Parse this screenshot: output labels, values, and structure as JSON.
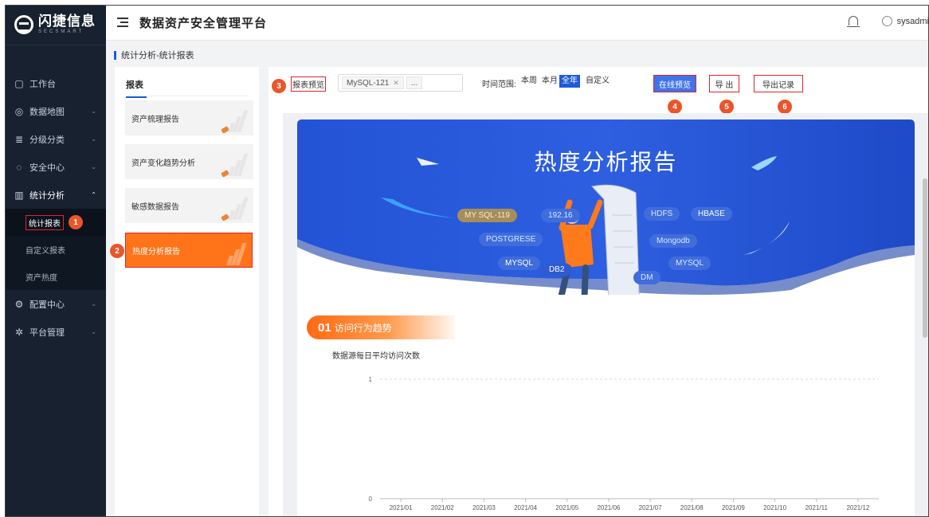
{
  "brand": {
    "name_cn": "闪捷信息",
    "name_en": "SECSMART"
  },
  "app": {
    "title": "数据资产安全管理平台"
  },
  "user": {
    "name": "sysadmi"
  },
  "breadcrumb": "统计分析-统计报表",
  "sidebar": {
    "items": [
      {
        "label": "工作台",
        "icon": "monitor-icon",
        "caret": false
      },
      {
        "label": "数据地图",
        "icon": "map-pin-icon",
        "caret": true
      },
      {
        "label": "分级分类",
        "icon": "layers-icon",
        "caret": true
      },
      {
        "label": "安全中心",
        "icon": "shield-icon",
        "caret": true
      },
      {
        "label": "统计分析",
        "icon": "bar-chart-icon",
        "caret": true,
        "open": true
      },
      {
        "label": "配置中心",
        "icon": "config-icon",
        "caret": true
      },
      {
        "label": "平台管理",
        "icon": "gear-icon",
        "caret": true
      }
    ],
    "sub_items": [
      {
        "label": "统计报表",
        "active": true
      },
      {
        "label": "自定义报表",
        "active": false
      },
      {
        "label": "资产热度",
        "active": false
      }
    ]
  },
  "report_panel": {
    "tab": "报表",
    "cards": [
      {
        "label": "资产梳理报告"
      },
      {
        "label": "资产变化趋势分析"
      },
      {
        "label": "敏感数据报告"
      },
      {
        "label": "热度分析报告",
        "active": true
      }
    ]
  },
  "toolbar": {
    "preview_label": "报表预览",
    "selected_tag": "MySQL-121",
    "more_tag": "...",
    "range_label": "时间范围:",
    "range_options": [
      "本周",
      "本月",
      "全年",
      "自定义"
    ],
    "range_active": "全年",
    "online_preview": "在线预览",
    "export": "导 出",
    "export_records": "导出记录"
  },
  "steps": [
    "1",
    "2",
    "3",
    "4",
    "5",
    "6"
  ],
  "report": {
    "banner_title": "热度分析报告",
    "db_tags": [
      "MY SQL-119",
      "192.16",
      "HDFS",
      "HBASE",
      "POSTGRESE",
      "Mongodb",
      "MYSQL",
      "DB2",
      "MYSQL",
      "DM"
    ],
    "section": {
      "num": "01",
      "title": "访问行为趋势"
    }
  },
  "colors": {
    "accent": "#1e5bd8",
    "orange": "#ff7419",
    "sidebar": "#17212f",
    "annotation": "#e0242a",
    "badge": "#e9562b"
  },
  "chart_data": {
    "type": "line",
    "title": "数据源每日平均访问次数",
    "categories": [
      "2021/01",
      "2021/02",
      "2021/03",
      "2021/04",
      "2021/05",
      "2021/06",
      "2021/07",
      "2021/08",
      "2021/09",
      "2021/10",
      "2021/11",
      "2021/12"
    ],
    "series": [],
    "yticks": [
      "1",
      "0"
    ],
    "ylim": [
      0,
      1
    ],
    "grid": "dashed-horizontal"
  }
}
